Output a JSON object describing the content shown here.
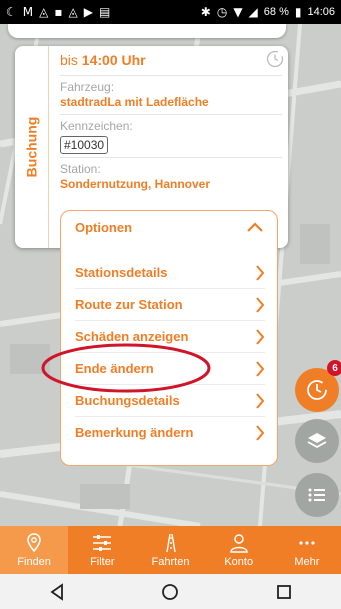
{
  "status_bar": {
    "left_icons": [
      "notification-c-icon",
      "gmail-icon",
      "photos-icon",
      "image-icon",
      "photos-icon",
      "youtube-icon",
      "calendar-icon"
    ],
    "battery_percent": "68 %",
    "time": "14:06"
  },
  "booking": {
    "tab_label": "Buchung",
    "until_prefix": "bis",
    "until_time": "14:00 Uhr",
    "vehicle_label": "Fahrzeug:",
    "vehicle_value": "stadtradLa mit Ladefläche",
    "plate_label": "Kennzeichen:",
    "plate_value": "#10030",
    "station_label": "Station:",
    "station_value": "Sondernutzung, Hannover"
  },
  "options": {
    "header": "Optionen",
    "items": [
      {
        "label": "Stationsdetails"
      },
      {
        "label": "Route zur Station"
      },
      {
        "label": "Schäden anzeigen"
      },
      {
        "label": "Ende ändern"
      },
      {
        "label": "Buchungsdetails"
      },
      {
        "label": "Bemerkung ändern"
      }
    ]
  },
  "fabs": {
    "badge_count": "6"
  },
  "bottom_nav": {
    "items": [
      {
        "label": "Finden",
        "icon": "location-pin-icon",
        "active": true
      },
      {
        "label": "Filter",
        "icon": "sliders-icon",
        "active": false
      },
      {
        "label": "Fahrten",
        "icon": "road-icon",
        "active": false
      },
      {
        "label": "Konto",
        "icon": "user-icon",
        "active": false
      },
      {
        "label": "Mehr",
        "icon": "more-dots-icon",
        "active": false
      }
    ]
  },
  "colors": {
    "accent": "#f07e26",
    "highlight": "#d0142a"
  }
}
